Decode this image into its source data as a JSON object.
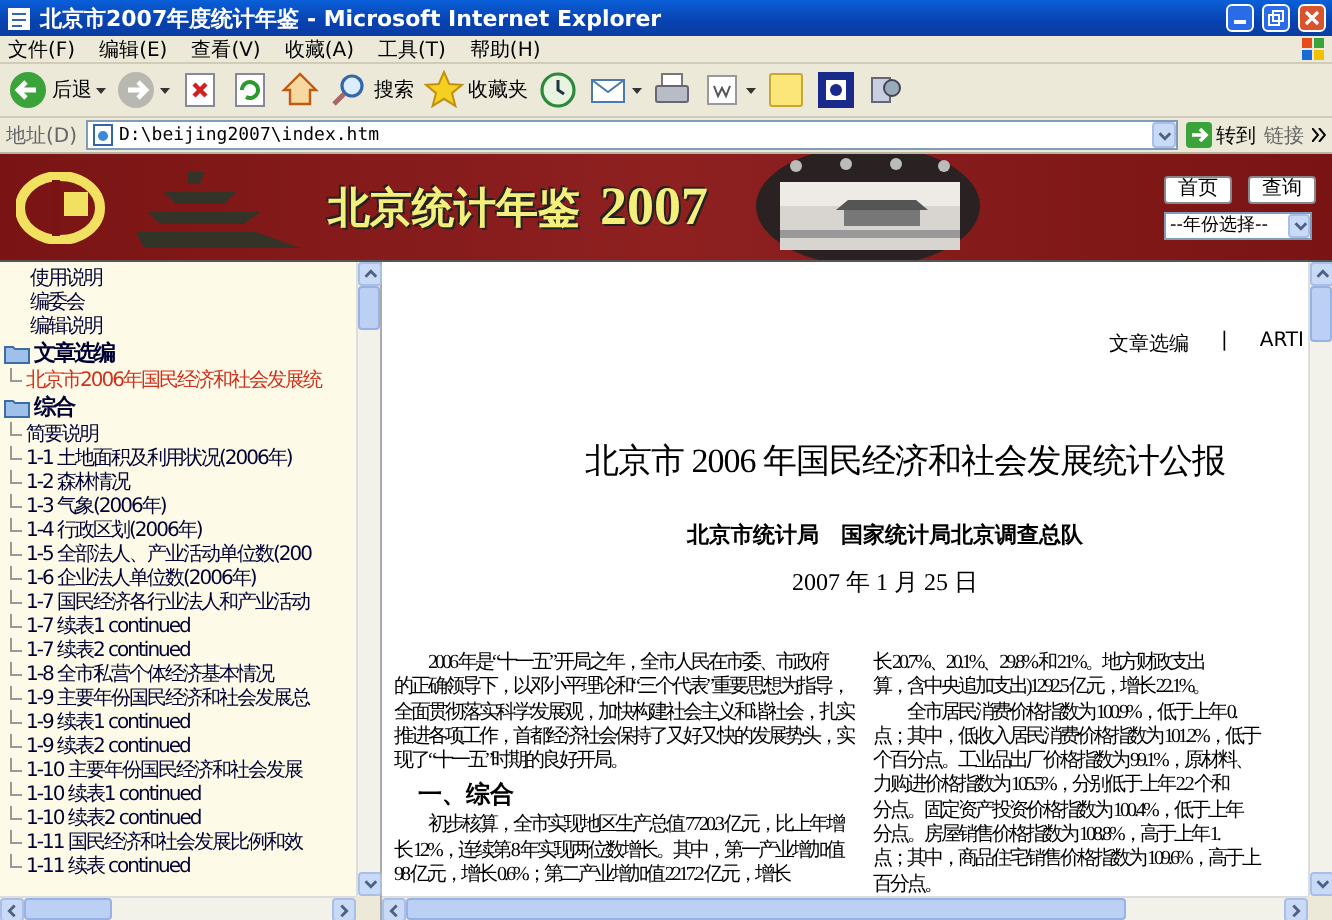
{
  "window": {
    "title": "北京市2007年度统计年鉴 - Microsoft Internet Explorer"
  },
  "menu": [
    "文件(F)",
    "编辑(E)",
    "查看(V)",
    "收藏(A)",
    "工具(T)",
    "帮助(H)"
  ],
  "toolbar": [
    {
      "kind": "back",
      "label": "后退"
    },
    {
      "kind": "forward"
    },
    {
      "kind": "stop"
    },
    {
      "kind": "refresh"
    },
    {
      "kind": "home"
    },
    {
      "kind": "search",
      "label": "搜索"
    },
    {
      "kind": "favorites",
      "label": "收藏夹"
    },
    {
      "kind": "history"
    },
    {
      "kind": "mail"
    },
    {
      "kind": "print"
    },
    {
      "kind": "edit"
    },
    {
      "kind": "note"
    },
    {
      "kind": "messenger"
    },
    {
      "kind": "research"
    }
  ],
  "address_bar": {
    "label": "地址(D)",
    "value": "D:\\beijing2007\\index.htm",
    "go": "转到",
    "links": "链接"
  },
  "banner": {
    "title": "北京统计年鉴",
    "year": "2007",
    "buttons": [
      "首页",
      "查询"
    ],
    "year_select": "--年份选择--"
  },
  "tree": [
    {
      "label": "使用说明"
    },
    {
      "label": "编委会"
    },
    {
      "label": "编辑说明"
    },
    {
      "label": "文章选编",
      "kind": "folder",
      "children": [
        {
          "label": "北京市2006年国民经济和社会发展统",
          "selected": true
        }
      ]
    },
    {
      "label": "综合",
      "kind": "folder",
      "children": [
        {
          "label": "简要说明",
          "selected": false
        },
        {
          "label": "1-1 土地面积及利用状况(2006年)",
          "selected": false
        },
        {
          "label": "1-2 森林情况",
          "selected": false
        },
        {
          "label": "1-3 气象(2006年)",
          "selected": false
        },
        {
          "label": "1-4 行政区划(2006年)",
          "selected": false
        },
        {
          "label": "1-5 全部法人、产业活动单位数(200",
          "selected": false
        },
        {
          "label": "1-6 企业法人单位数(2006年)",
          "selected": false
        },
        {
          "label": "1-7 国民经济各行业法人和产业活动",
          "selected": false
        },
        {
          "label": "1-7 续表1 continued",
          "selected": false
        },
        {
          "label": "1-7 续表2 continued",
          "selected": false
        },
        {
          "label": "1-8 全市私营个体经济基本情况",
          "selected": false
        },
        {
          "label": "1-9 主要年份国民经济和社会发展总",
          "selected": false
        },
        {
          "label": "1-9 续表1 continued",
          "selected": false
        },
        {
          "label": "1-9 续表2 continued",
          "selected": false
        },
        {
          "label": "1-10 主要年份国民经济和社会发展",
          "selected": false
        },
        {
          "label": "1-10 续表1 continued",
          "selected": false
        },
        {
          "label": "1-10 续表2 continued",
          "selected": false
        },
        {
          "label": "1-11 国民经济和社会发展比例和效",
          "selected": false
        },
        {
          "label": "1-11 续表 continued",
          "selected": false
        }
      ]
    }
  ],
  "document": {
    "header": [
      "文章选编",
      "|",
      "ARTI"
    ],
    "title": "北京市 2006 年国民经济和社会发展统计公报",
    "authors": "北京市统计局　国家统计局北京调查总队",
    "date": "2007 年 1 月 25 日",
    "column_1": [
      {
        "kind": "first",
        "text": "2006 年是“十一五”开局之年，全市人民在市委、市政府"
      },
      {
        "kind": "line",
        "text": "的正确领导下，以邓小平理论和“三个代表”重要思想为指导，"
      },
      {
        "kind": "line",
        "text": "全面贯彻落实科学发展观，加快构建社会主义和谐社会，扎实"
      },
      {
        "kind": "line",
        "text": "推进各项工作，首都经济社会保持了又好又快的发展势头，实"
      },
      {
        "kind": "line",
        "text": "现了“十一五”时期的良好开局。"
      },
      {
        "kind": "heading",
        "text": "一、综合"
      },
      {
        "kind": "first",
        "text": "初步核算，全市实现地区生产总值 7720.3 亿元，比上年增"
      },
      {
        "kind": "line",
        "text": "长 12%，连续第 8 年实现两位数增长。其中，第一产业增加值"
      },
      {
        "kind": "line",
        "text": "98 亿元，增长 0.6%；第二产业增加值 2217.2 亿元，增长"
      }
    ],
    "column_2": [
      {
        "kind": "line",
        "text": "长 20.7%、20.1%、29.8% 和 21%。地方财政支出"
      },
      {
        "kind": "line",
        "text": "算，含中央追加支出)1292.5 亿元，增长 22.1%。"
      },
      {
        "kind": "first",
        "text": "全市居民消费价格指数为 100.9%，低于上年 0."
      },
      {
        "kind": "line",
        "text": "点；其中，低收入居民消费价格指数为 101.2%，低于"
      },
      {
        "kind": "line",
        "text": "个百分点。工业品出厂价格指数为 99.1%，原材料、"
      },
      {
        "kind": "line",
        "text": "力购进价格指数为 105.5%，分别低于上年 2.2 个和"
      },
      {
        "kind": "line",
        "text": "分点。固定资产投资价格指数为 100.4%，低于上年"
      },
      {
        "kind": "line",
        "text": "分点。房屋销售价格指数为 108.8%，高于上年 1."
      },
      {
        "kind": "line",
        "text": "点；其中，商品住宅销售价格指数为 109.6%，高于上"
      },
      {
        "kind": "line",
        "text": "百分点。"
      }
    ]
  }
}
